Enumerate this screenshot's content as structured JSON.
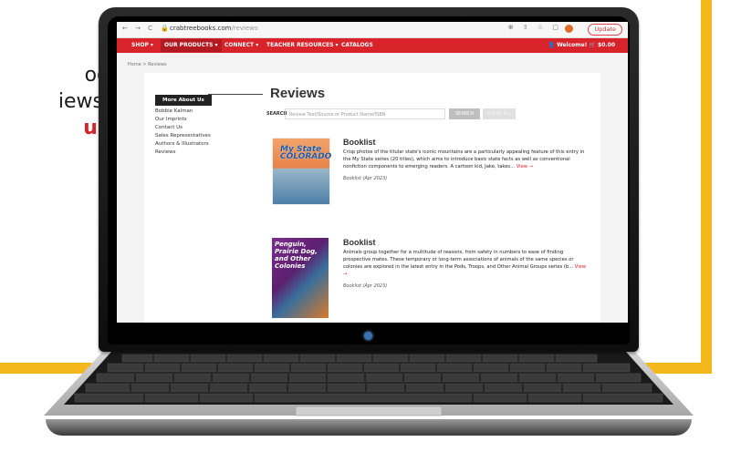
{
  "promo": {
    "line1": "og",
    "line2": "iews.",
    "line3": "us"
  },
  "browser": {
    "nav_icons": "← → C",
    "url_domain": "crabtreebooks.com",
    "url_path": "/reviews",
    "toolbar_icons": "⊕ ⇧ ☆ ▢",
    "update_label": "Update"
  },
  "navbar": {
    "items": [
      "SHOP ▾",
      "OUR PRODUCTS ▾",
      "CONNECT ▾",
      "TEACHER RESOURCES ▾",
      "CATALOGS"
    ],
    "welcome": "Welcome!",
    "cart": "$0.00"
  },
  "breadcrumb": "Home > Reviews",
  "sidebar": {
    "heading": "More About Us",
    "items": [
      "Bobbie Kalman",
      "Our Imprints",
      "Contact Us",
      "Sales Representatives",
      "Authors & Illustrators",
      "Reviews"
    ]
  },
  "main": {
    "title": "Reviews",
    "search_label": "SEARCH",
    "search_placeholder": "Review Text/Source or Product Name/ISBN",
    "search_button": "SEARCH",
    "clear_button": "CLEAR ALL"
  },
  "reviews": [
    {
      "cover_text": "My State COLORADO",
      "title": "Booklist",
      "body": "Crisp photos of the titular state's iconic mountains are a particularly appealing feature of this entry in the My State series (20 titles), which aims to introduce basic state facts as well as conventional nonfiction components to emerging readers. A cartoon kid, Jake, takes...",
      "more": "View →",
      "source": "Booklist (Apr 2023)"
    },
    {
      "cover_text": "Penguin, Prairie Dog, and Other Colonies",
      "title": "Booklist",
      "body": "Animals group together for a multitude of reasons, from safety in numbers to ease of finding prospective mates. These temporary or long-term associations of animals of the same species or colonies are explored in the latest entry in the Pods, Troops, and Other Animal Groups series (b...",
      "more": "View →",
      "source": "Booklist (Apr 2023)"
    }
  ],
  "colors": {
    "brand_red": "#d8232a",
    "accent_yellow": "#f4b81c"
  }
}
